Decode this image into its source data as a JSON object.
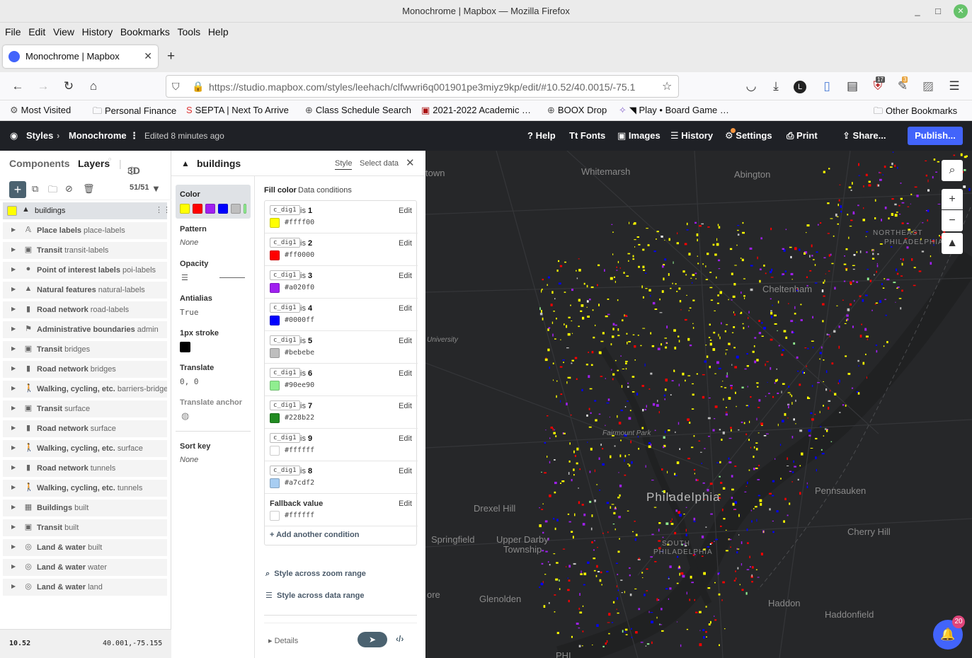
{
  "window": {
    "title": "Monochrome | Mapbox — Mozilla Firefox",
    "minimize": "_",
    "maximize": "□",
    "close": "✕"
  },
  "menu": [
    "File",
    "Edit",
    "View",
    "History",
    "Bookmarks",
    "Tools",
    "Help"
  ],
  "tab": {
    "title": "Monochrome | Mapbox",
    "close": "✕",
    "new": "+"
  },
  "nav": {
    "url": "https://studio.mapbox.com/styles/leehach/clfwwri6q001901pe3miyz9kp/edit/#10.52/40.0015/-75.1",
    "ext_badge_1": "17",
    "ext_badge_2": "3"
  },
  "bookmarks": [
    "Most Visited",
    "Personal Finance",
    "SEPTA | Next To Arrive",
    "Class Schedule Search",
    "2021-2022 Academic …",
    "BOOX Drop",
    "◥ Play • Board Game …",
    "Other Bookmarks"
  ],
  "app": {
    "styles": "Styles",
    "style_name": "Monochrome",
    "edited": "Edited 8 minutes ago",
    "help": "Help",
    "fonts": "Fonts",
    "images": "Images",
    "history": "History",
    "settings": "Settings",
    "print": "Print",
    "share": "Share...",
    "publish": "Publish..."
  },
  "left": {
    "tab_components": "Components",
    "tab_layers": "Layers",
    "tab_3d": "3D",
    "count": "51/51",
    "selected_layer": "buildings",
    "layers": [
      {
        "name": "Place labels",
        "id": "place-labels",
        "icon": "𝔸"
      },
      {
        "name": "Transit",
        "id": "transit-labels",
        "icon": "▣"
      },
      {
        "name": "Point of interest labels",
        "id": "poi-labels",
        "icon": "●"
      },
      {
        "name": "Natural features",
        "id": "natural-labels",
        "icon": "▲"
      },
      {
        "name": "Road network",
        "id": "road-labels",
        "icon": "▮"
      },
      {
        "name": "Administrative boundaries",
        "id": "admin",
        "icon": "⚑"
      },
      {
        "name": "Transit",
        "id": "bridges",
        "icon": "▣"
      },
      {
        "name": "Road network",
        "id": "bridges",
        "icon": "▮"
      },
      {
        "name": "Walking, cycling, etc.",
        "id": "barriers-bridges",
        "icon": "🚶"
      },
      {
        "name": "Transit",
        "id": "surface",
        "icon": "▣"
      },
      {
        "name": "Road network",
        "id": "surface",
        "icon": "▮"
      },
      {
        "name": "Walking, cycling, etc.",
        "id": "surface",
        "icon": "🚶"
      },
      {
        "name": "Road network",
        "id": "tunnels",
        "icon": "▮"
      },
      {
        "name": "Walking, cycling, etc.",
        "id": "tunnels",
        "icon": "🚶"
      },
      {
        "name": "Buildings",
        "id": "built",
        "icon": "▦"
      },
      {
        "name": "Transit",
        "id": "built",
        "icon": "▣"
      },
      {
        "name": "Land & water",
        "id": "built",
        "icon": "◎"
      },
      {
        "name": "Land & water",
        "id": "water",
        "icon": "◎"
      },
      {
        "name": "Land & water",
        "id": "land",
        "icon": "◎"
      }
    ],
    "zoom": "10.52",
    "coords": "40.001,-75.155"
  },
  "mid": {
    "layer_title": "buildings",
    "tab_style": "Style",
    "tab_select": "Select data",
    "close": "✕",
    "props": {
      "color": "Color",
      "pattern": "Pattern",
      "pattern_val": "None",
      "opacity": "Opacity",
      "antialias": "Antialias",
      "antialias_val": "True",
      "stroke": "1px stroke",
      "translate": "Translate",
      "translate_val": "0, 0",
      "translate_anchor": "Translate anchor",
      "sort_key": "Sort key",
      "sort_key_val": "None"
    },
    "fill_color": "Fill color",
    "data_conditions": "Data conditions",
    "is": "is",
    "edit": "Edit",
    "conditions": [
      {
        "key": "c_dig1",
        "value": "1",
        "hex": "#ffff00"
      },
      {
        "key": "c_dig1",
        "value": "2",
        "hex": "#ff0000"
      },
      {
        "key": "c_dig1",
        "value": "3",
        "hex": "#a020f0"
      },
      {
        "key": "c_dig1",
        "value": "4",
        "hex": "#0000ff"
      },
      {
        "key": "c_dig1",
        "value": "5",
        "hex": "#bebebe"
      },
      {
        "key": "c_dig1",
        "value": "6",
        "hex": "#90ee90"
      },
      {
        "key": "c_dig1",
        "value": "7",
        "hex": "#228b22"
      },
      {
        "key": "c_dig1",
        "value": "9",
        "hex": "#ffffff"
      },
      {
        "key": "c_dig1",
        "value": "8",
        "hex": "#a7cdf2"
      }
    ],
    "fallback_label": "Fallback value",
    "fallback_hex": "#ffffff",
    "add_condition": "Add another condition",
    "zoom_range": "Style across zoom range",
    "data_range": "Style across data range",
    "details": "Details"
  },
  "map": {
    "labels": [
      "town",
      "Whitemarsh",
      "Abington",
      "NORTHEAST",
      "PHILADELPHIA",
      "Cheltenham",
      "University",
      "Fairmount Park",
      "Philadelphia",
      "Drexel Hill",
      "Pennsauken",
      "Springfield",
      "Upper Darby",
      "Township",
      "SOUTH",
      "PHILADELPHIA",
      "Cherry Hill",
      "ore",
      "Glenolden",
      "Haddon",
      "Haddonfield",
      "PHI"
    ],
    "notifications": "20",
    "zoom_in": "+",
    "zoom_out": "−"
  }
}
